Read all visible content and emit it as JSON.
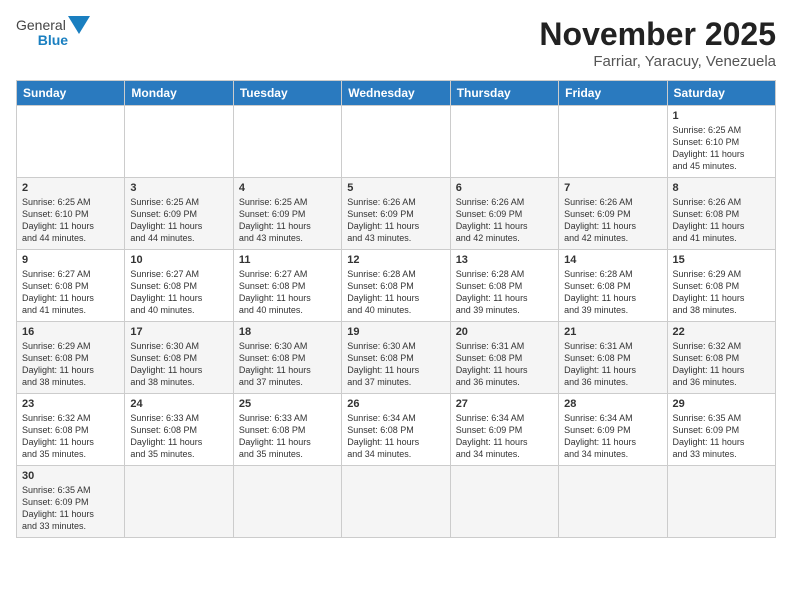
{
  "header": {
    "title": "November 2025",
    "location": "Farriar, Yaracuy, Venezuela",
    "logo_general": "General",
    "logo_blue": "Blue"
  },
  "days_of_week": [
    "Sunday",
    "Monday",
    "Tuesday",
    "Wednesday",
    "Thursday",
    "Friday",
    "Saturday"
  ],
  "weeks": [
    [
      {
        "day": "",
        "text": ""
      },
      {
        "day": "",
        "text": ""
      },
      {
        "day": "",
        "text": ""
      },
      {
        "day": "",
        "text": ""
      },
      {
        "day": "",
        "text": ""
      },
      {
        "day": "",
        "text": ""
      },
      {
        "day": "1",
        "text": "Sunrise: 6:25 AM\nSunset: 6:10 PM\nDaylight: 11 hours\nand 45 minutes."
      }
    ],
    [
      {
        "day": "2",
        "text": "Sunrise: 6:25 AM\nSunset: 6:10 PM\nDaylight: 11 hours\nand 44 minutes."
      },
      {
        "day": "3",
        "text": "Sunrise: 6:25 AM\nSunset: 6:09 PM\nDaylight: 11 hours\nand 44 minutes."
      },
      {
        "day": "4",
        "text": "Sunrise: 6:25 AM\nSunset: 6:09 PM\nDaylight: 11 hours\nand 43 minutes."
      },
      {
        "day": "5",
        "text": "Sunrise: 6:26 AM\nSunset: 6:09 PM\nDaylight: 11 hours\nand 43 minutes."
      },
      {
        "day": "6",
        "text": "Sunrise: 6:26 AM\nSunset: 6:09 PM\nDaylight: 11 hours\nand 42 minutes."
      },
      {
        "day": "7",
        "text": "Sunrise: 6:26 AM\nSunset: 6:09 PM\nDaylight: 11 hours\nand 42 minutes."
      },
      {
        "day": "8",
        "text": "Sunrise: 6:26 AM\nSunset: 6:08 PM\nDaylight: 11 hours\nand 41 minutes."
      }
    ],
    [
      {
        "day": "9",
        "text": "Sunrise: 6:27 AM\nSunset: 6:08 PM\nDaylight: 11 hours\nand 41 minutes."
      },
      {
        "day": "10",
        "text": "Sunrise: 6:27 AM\nSunset: 6:08 PM\nDaylight: 11 hours\nand 40 minutes."
      },
      {
        "day": "11",
        "text": "Sunrise: 6:27 AM\nSunset: 6:08 PM\nDaylight: 11 hours\nand 40 minutes."
      },
      {
        "day": "12",
        "text": "Sunrise: 6:28 AM\nSunset: 6:08 PM\nDaylight: 11 hours\nand 40 minutes."
      },
      {
        "day": "13",
        "text": "Sunrise: 6:28 AM\nSunset: 6:08 PM\nDaylight: 11 hours\nand 39 minutes."
      },
      {
        "day": "14",
        "text": "Sunrise: 6:28 AM\nSunset: 6:08 PM\nDaylight: 11 hours\nand 39 minutes."
      },
      {
        "day": "15",
        "text": "Sunrise: 6:29 AM\nSunset: 6:08 PM\nDaylight: 11 hours\nand 38 minutes."
      }
    ],
    [
      {
        "day": "16",
        "text": "Sunrise: 6:29 AM\nSunset: 6:08 PM\nDaylight: 11 hours\nand 38 minutes."
      },
      {
        "day": "17",
        "text": "Sunrise: 6:30 AM\nSunset: 6:08 PM\nDaylight: 11 hours\nand 38 minutes."
      },
      {
        "day": "18",
        "text": "Sunrise: 6:30 AM\nSunset: 6:08 PM\nDaylight: 11 hours\nand 37 minutes."
      },
      {
        "day": "19",
        "text": "Sunrise: 6:30 AM\nSunset: 6:08 PM\nDaylight: 11 hours\nand 37 minutes."
      },
      {
        "day": "20",
        "text": "Sunrise: 6:31 AM\nSunset: 6:08 PM\nDaylight: 11 hours\nand 36 minutes."
      },
      {
        "day": "21",
        "text": "Sunrise: 6:31 AM\nSunset: 6:08 PM\nDaylight: 11 hours\nand 36 minutes."
      },
      {
        "day": "22",
        "text": "Sunrise: 6:32 AM\nSunset: 6:08 PM\nDaylight: 11 hours\nand 36 minutes."
      }
    ],
    [
      {
        "day": "23",
        "text": "Sunrise: 6:32 AM\nSunset: 6:08 PM\nDaylight: 11 hours\nand 35 minutes."
      },
      {
        "day": "24",
        "text": "Sunrise: 6:33 AM\nSunset: 6:08 PM\nDaylight: 11 hours\nand 35 minutes."
      },
      {
        "day": "25",
        "text": "Sunrise: 6:33 AM\nSunset: 6:08 PM\nDaylight: 11 hours\nand 35 minutes."
      },
      {
        "day": "26",
        "text": "Sunrise: 6:34 AM\nSunset: 6:08 PM\nDaylight: 11 hours\nand 34 minutes."
      },
      {
        "day": "27",
        "text": "Sunrise: 6:34 AM\nSunset: 6:09 PM\nDaylight: 11 hours\nand 34 minutes."
      },
      {
        "day": "28",
        "text": "Sunrise: 6:34 AM\nSunset: 6:09 PM\nDaylight: 11 hours\nand 34 minutes."
      },
      {
        "day": "29",
        "text": "Sunrise: 6:35 AM\nSunset: 6:09 PM\nDaylight: 11 hours\nand 33 minutes."
      }
    ],
    [
      {
        "day": "30",
        "text": "Sunrise: 6:35 AM\nSunset: 6:09 PM\nDaylight: 11 hours\nand 33 minutes."
      },
      {
        "day": "",
        "text": ""
      },
      {
        "day": "",
        "text": ""
      },
      {
        "day": "",
        "text": ""
      },
      {
        "day": "",
        "text": ""
      },
      {
        "day": "",
        "text": ""
      },
      {
        "day": "",
        "text": ""
      }
    ]
  ]
}
